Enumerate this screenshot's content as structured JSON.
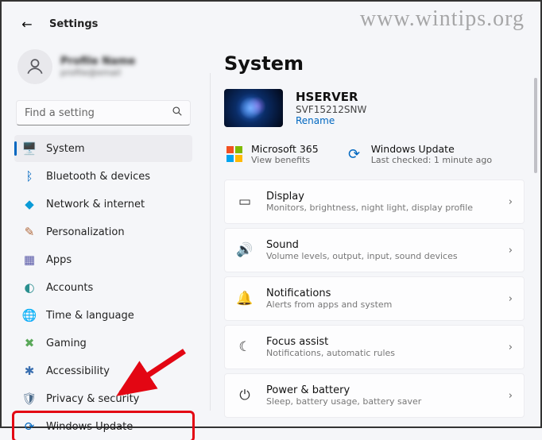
{
  "header": {
    "title": "Settings"
  },
  "watermark": "www.wintips.org",
  "profile": {
    "name": "Profile Name",
    "email": "profile@email"
  },
  "search": {
    "placeholder": "Find a setting"
  },
  "sidebar": {
    "items": [
      {
        "label": "System",
        "icon": "🖥️",
        "color": "#3a3a3a",
        "active": true
      },
      {
        "label": "Bluetooth & devices",
        "icon": "ᛒ",
        "color": "#0067c0"
      },
      {
        "label": "Network & internet",
        "icon": "◆",
        "color": "#0b9bd7"
      },
      {
        "label": "Personalization",
        "icon": "✎",
        "color": "#b26b3f"
      },
      {
        "label": "Apps",
        "icon": "▦",
        "color": "#5a5aa8"
      },
      {
        "label": "Accounts",
        "icon": "◐",
        "color": "#2a8f8f"
      },
      {
        "label": "Time & language",
        "icon": "🌐",
        "color": "#2a7aaa"
      },
      {
        "label": "Gaming",
        "icon": "✖",
        "color": "#5aa85a"
      },
      {
        "label": "Accessibility",
        "icon": "✱",
        "color": "#3a6fb0"
      },
      {
        "label": "Privacy & security",
        "icon": "🛡",
        "color": "#4a6a8a"
      },
      {
        "label": "Windows Update",
        "icon": "⟳",
        "color": "#0067c0",
        "highlight": true
      }
    ]
  },
  "main": {
    "title": "System",
    "device": {
      "name": "HSERVER",
      "model": "SVF15212SNW",
      "rename": "Rename"
    },
    "tiles": [
      {
        "title": "Microsoft 365",
        "sub": "View benefits"
      },
      {
        "title": "Windows Update",
        "sub": "Last checked: 1 minute ago"
      }
    ],
    "cards": [
      {
        "icon": "▭",
        "title": "Display",
        "sub": "Monitors, brightness, night light, display profile"
      },
      {
        "icon": "🔊",
        "title": "Sound",
        "sub": "Volume levels, output, input, sound devices"
      },
      {
        "icon": "🔔",
        "title": "Notifications",
        "sub": "Alerts from apps and system"
      },
      {
        "icon": "☾",
        "title": "Focus assist",
        "sub": "Notifications, automatic rules"
      },
      {
        "icon": "⏻",
        "title": "Power & battery",
        "sub": "Sleep, battery usage, battery saver"
      }
    ]
  }
}
